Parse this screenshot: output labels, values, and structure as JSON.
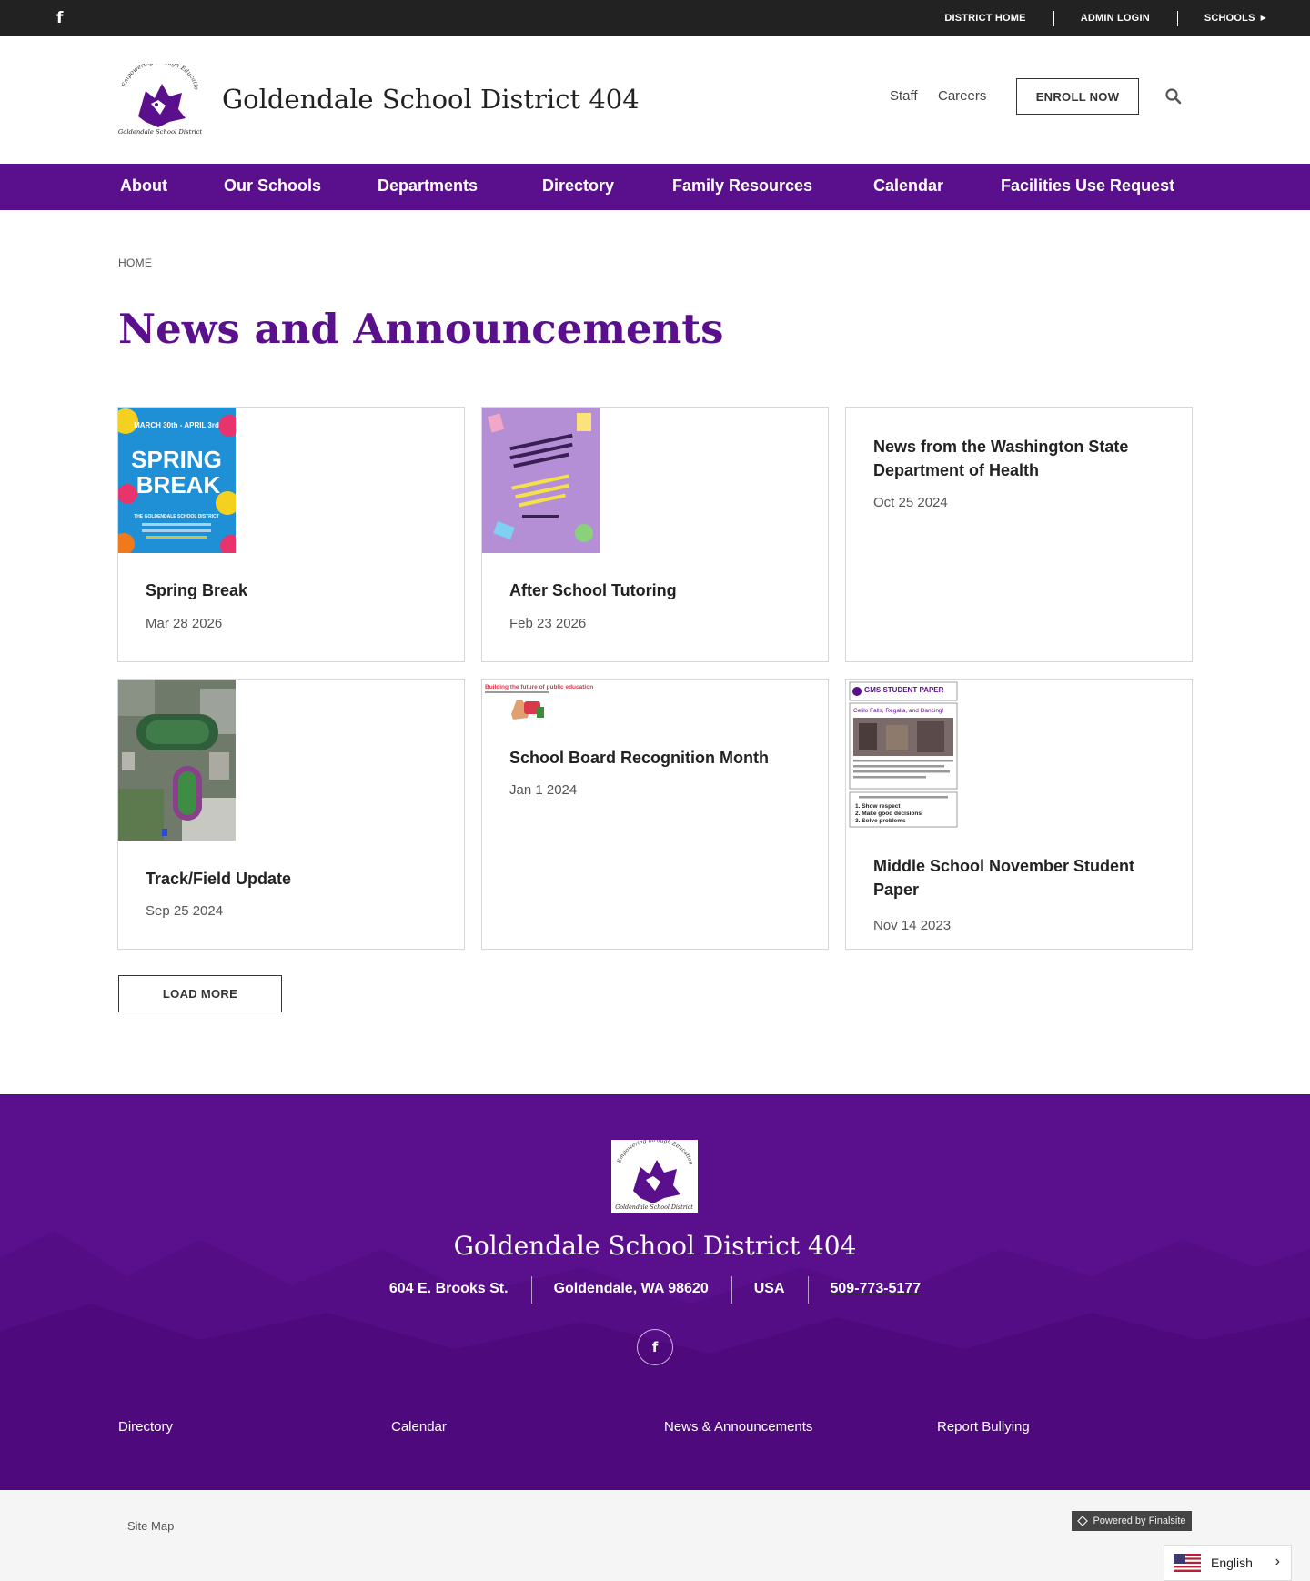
{
  "topbar": {
    "facebook_icon": "facebook-icon",
    "links": [
      "DISTRICT HOME",
      "ADMIN LOGIN",
      "SCHOOLS"
    ]
  },
  "header": {
    "logo_arc_text": "Empowering through Education",
    "logo_caption": "Goldendale School District",
    "title": "Goldendale School District 404",
    "util_links": [
      "Staff",
      "Careers"
    ],
    "enroll_label": "ENROLL NOW",
    "search_icon": "search-icon"
  },
  "nav": {
    "items": [
      "About",
      "Our Schools",
      "Departments",
      "Directory",
      "Family Resources",
      "Calendar",
      "Facilities Use Request"
    ]
  },
  "breadcrumb": "HOME",
  "page_title": "News and Announcements",
  "cards": [
    {
      "title": "Spring Break",
      "date": "Mar 28 2026",
      "thumb": "spring-break"
    },
    {
      "title": "After School Tutoring",
      "date": "Feb 23 2026",
      "thumb": "tutoring"
    },
    {
      "title": "News from the Washington State Department of Health",
      "date": "Oct 25 2024"
    },
    {
      "title": "Track/Field Update",
      "date": "Sep 25 2024",
      "thumb": "aerial"
    },
    {
      "title": "School Board Recognition Month",
      "date": "Jan 1 2024",
      "thumb": "board"
    },
    {
      "title": "Middle School November Student Paper",
      "date": "Nov 14 2023",
      "thumb": "paper"
    }
  ],
  "thumbs": {
    "spring": {
      "top": "MARCH 30th - APRIL 3rd",
      "big1": "SPRING",
      "big2": "BREAK",
      "district": "THE GOLDENDALE SCHOOL DISTRICT"
    },
    "board_caption": "Building the future of public education",
    "paper_head": "GMS STUDENT PAPER",
    "paper_sub": "Celilo Falls, Regalia, and Dancing!",
    "paper_list": [
      "1. Show respect",
      "2. Make good decisions",
      "3. Solve problems"
    ]
  },
  "load_more": "LOAD MORE",
  "footer": {
    "title": "Goldendale School District 404",
    "address": [
      "604 E. Brooks St.",
      "Goldendale, WA  98620",
      "USA",
      "509-773-5177"
    ],
    "links": [
      "Directory",
      "Calendar",
      "News & Announcements",
      "Report Bullying"
    ]
  },
  "bottom": {
    "sitemap": "Site Map",
    "powered": "Powered by Finalsite",
    "language": "English"
  },
  "colors": {
    "brand_purple": "#5a0f8c",
    "topbar": "#222222"
  }
}
